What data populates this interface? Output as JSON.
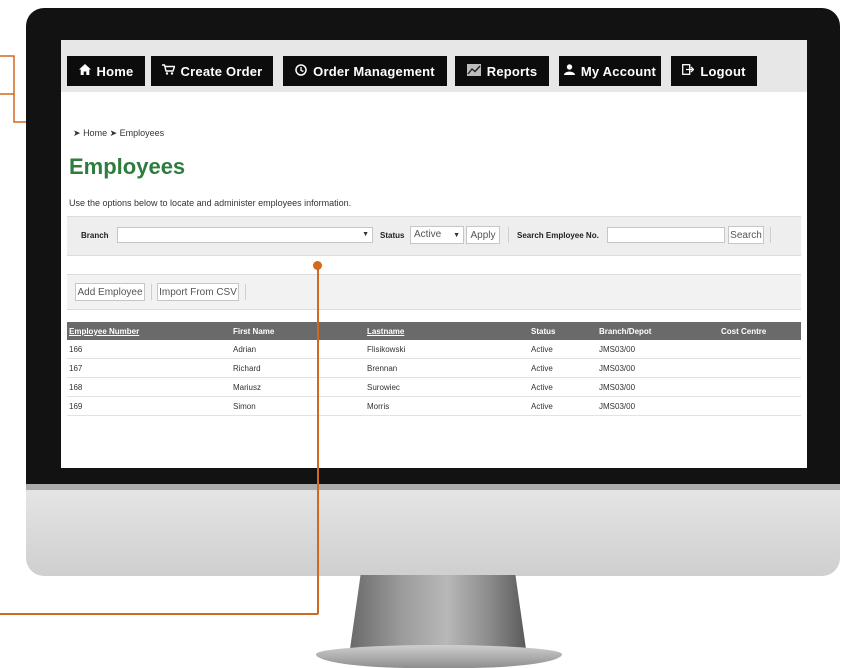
{
  "nav": {
    "items": [
      {
        "label": "Home",
        "icon": "home-icon"
      },
      {
        "label": "Create Order",
        "icon": "cart-icon"
      },
      {
        "label": "Order Management",
        "icon": "clock-icon"
      },
      {
        "label": "Reports",
        "icon": "chart-icon"
      },
      {
        "label": "My Account",
        "icon": "user-icon"
      },
      {
        "label": "Logout",
        "icon": "logout-icon"
      }
    ]
  },
  "breadcrumb": {
    "home": "Home",
    "current": "Employees"
  },
  "page": {
    "title": "Employees",
    "description": "Use the options below to locate and administer employees information."
  },
  "filters": {
    "branch_label": "Branch",
    "branch_value": "",
    "status_label": "Status",
    "status_value": "Active",
    "apply_label": "Apply",
    "search_label": "Search Employee No.",
    "search_button": "Search"
  },
  "actions": {
    "add_employee": "Add Employee",
    "import_csv": "Import From CSV"
  },
  "table": {
    "headers": [
      "Employee Number",
      "First Name",
      "Lastname",
      "Status",
      "Branch/Depot",
      "Cost Centre"
    ],
    "rows": [
      [
        "166",
        "Adrian",
        "Flisikowski",
        "Active",
        "JMS03/00",
        ""
      ],
      [
        "167",
        "Richard",
        "Brennan",
        "Active",
        "JMS03/00",
        ""
      ],
      [
        "168",
        "Mariusz",
        "Surowiec",
        "Active",
        "JMS03/00",
        ""
      ],
      [
        "169",
        "Simon",
        "Morris",
        "Active",
        "JMS03/00",
        ""
      ]
    ]
  },
  "colors": {
    "accent_orange": "#d1691e",
    "title_green": "#2e7d3f",
    "nav_black": "#0c0c0c"
  }
}
